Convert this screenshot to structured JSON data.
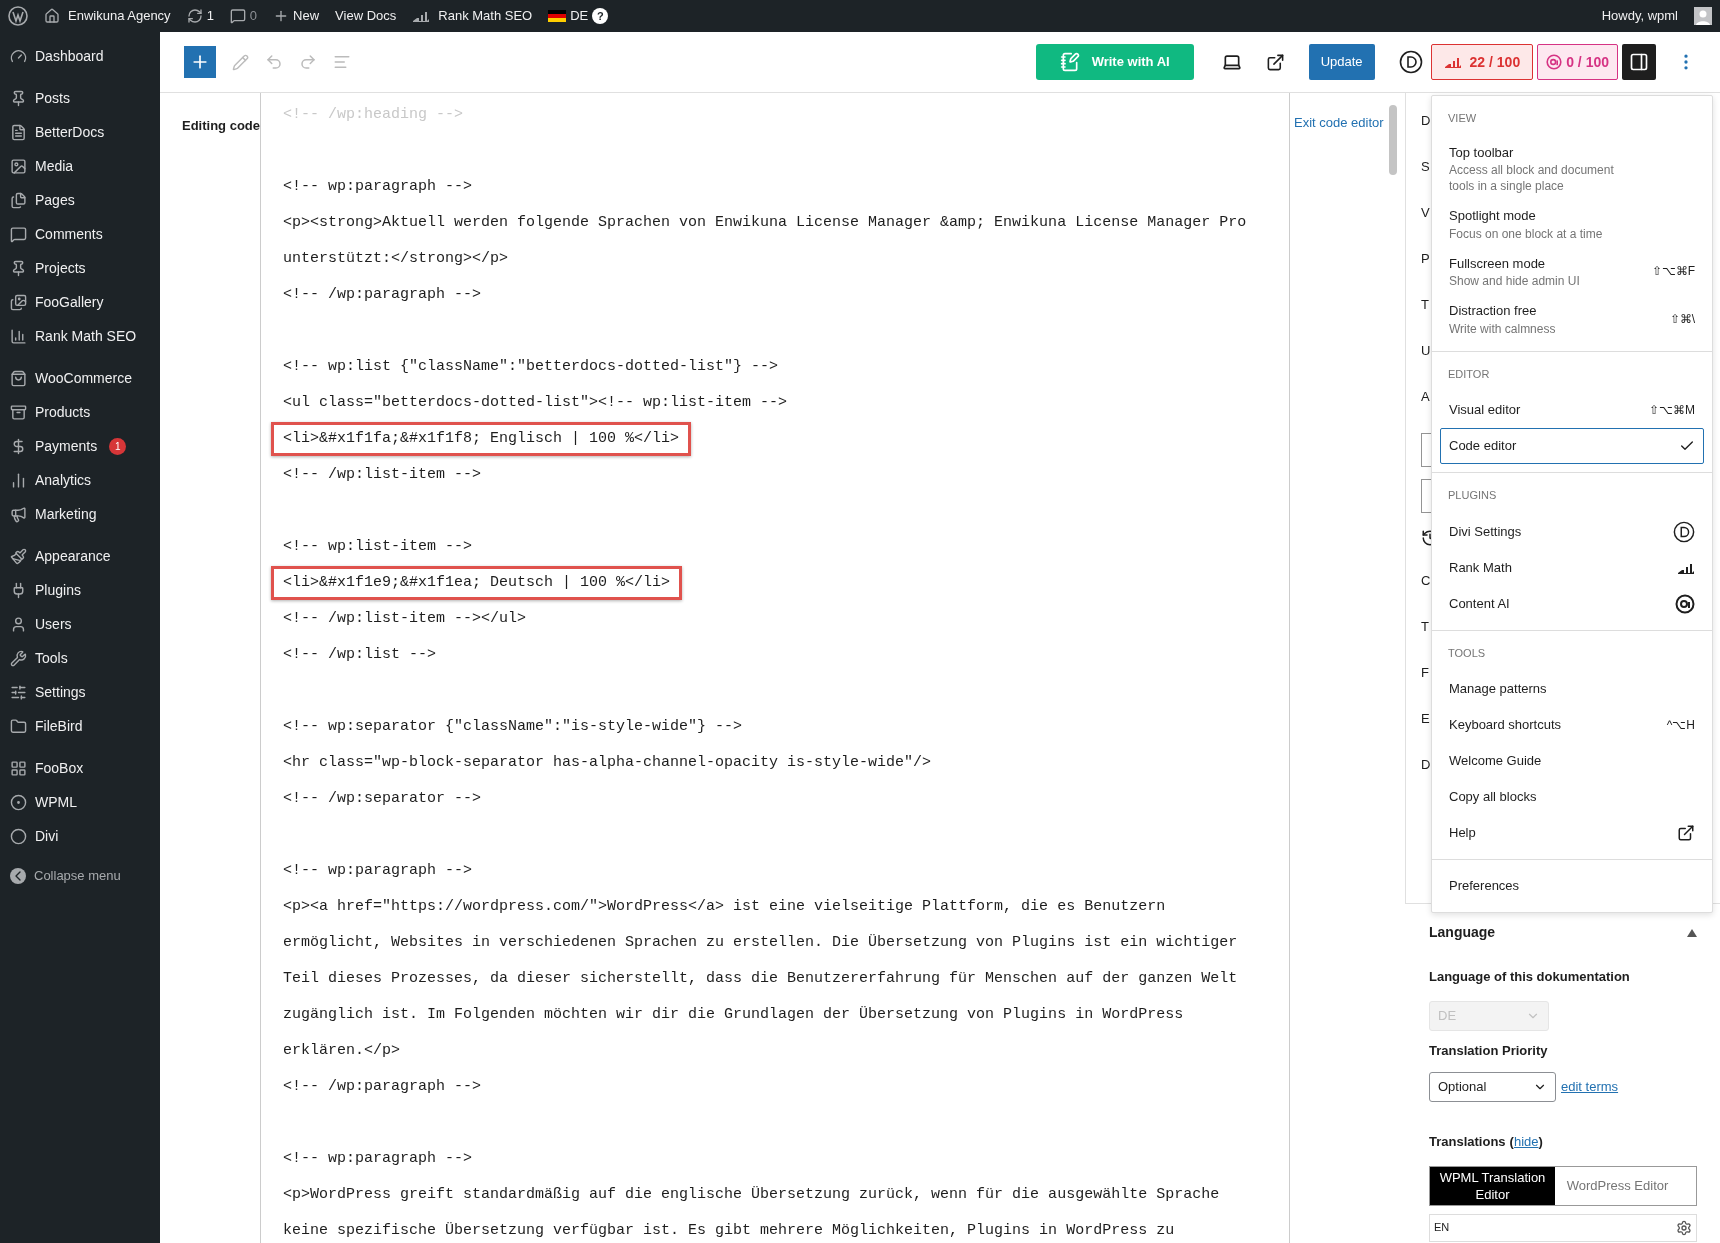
{
  "admin_bar": {
    "site": "Enwikuna Agency",
    "updates": "1",
    "comments": "0",
    "new": "New",
    "view_docs": "View Docs",
    "seo": "Rank Math SEO",
    "language": "DE",
    "help": "?",
    "greeting": "Howdy, wpml"
  },
  "sidebar": {
    "groups": [
      [
        {
          "label": "Dashboard"
        }
      ],
      [
        {
          "label": "Posts"
        },
        {
          "label": "BetterDocs"
        },
        {
          "label": "Media"
        },
        {
          "label": "Pages"
        },
        {
          "label": "Comments"
        },
        {
          "label": "Projects"
        },
        {
          "label": "FooGallery"
        },
        {
          "label": "Rank Math SEO"
        }
      ],
      [
        {
          "label": "WooCommerce"
        },
        {
          "label": "Products"
        },
        {
          "label": "Payments",
          "badge": "1"
        },
        {
          "label": "Analytics"
        },
        {
          "label": "Marketing"
        }
      ],
      [
        {
          "label": "Appearance"
        },
        {
          "label": "Plugins"
        },
        {
          "label": "Users"
        },
        {
          "label": "Tools"
        },
        {
          "label": "Settings"
        },
        {
          "label": "FileBird"
        }
      ],
      [
        {
          "label": "FooBox"
        },
        {
          "label": "WPML"
        },
        {
          "label": "Divi"
        }
      ]
    ],
    "collapse": "Collapse menu"
  },
  "toolbar": {
    "write_ai": "Write with AI",
    "update": "Update",
    "seo_score": "22 / 100",
    "ai_score": "0 / 100",
    "settings_open": true
  },
  "editor": {
    "label": "Editing code",
    "exit": "Exit code editor",
    "blocks": [
      {
        "dimmed": true,
        "lines": [
          {
            "text": "<!-- /wp:heading -->",
            "highlighted": false
          }
        ]
      },
      {
        "dimmed": false,
        "lines": [
          {
            "text": "<!-- wp:paragraph -->",
            "highlighted": false
          },
          {
            "text": "<p><strong>Aktuell werden folgende Sprachen von Enwikuna License Manager &amp; Enwikuna License Manager Pro",
            "highlighted": false
          },
          {
            "text": "unterstützt:</strong></p>",
            "highlighted": false
          },
          {
            "text": "<!-- /wp:paragraph -->",
            "highlighted": false
          }
        ]
      },
      {
        "dimmed": false,
        "lines": [
          {
            "text": "<!-- wp:list {\"className\":\"betterdocs-dotted-list\"} -->",
            "highlighted": false
          },
          {
            "text": "<ul class=\"betterdocs-dotted-list\"><!-- wp:list-item -->",
            "highlighted": false
          },
          {
            "text": "<li>&#x1f1fa;&#x1f1f8; Englisch | 100 %</li>",
            "highlighted": true
          },
          {
            "text": "<!-- /wp:list-item -->",
            "highlighted": false
          }
        ]
      },
      {
        "dimmed": false,
        "lines": [
          {
            "text": "<!-- wp:list-item -->",
            "highlighted": false
          },
          {
            "text": "<li>&#x1f1e9;&#x1f1ea; Deutsch | 100 %</li>",
            "highlighted": true
          },
          {
            "text": "<!-- /wp:list-item --></ul>",
            "highlighted": false
          },
          {
            "text": "<!-- /wp:list -->",
            "highlighted": false
          }
        ]
      },
      {
        "dimmed": false,
        "lines": [
          {
            "text": "<!-- wp:separator {\"className\":\"is-style-wide\"} -->",
            "highlighted": false
          },
          {
            "text": "<hr class=\"wp-block-separator has-alpha-channel-opacity is-style-wide\"/>",
            "highlighted": false
          },
          {
            "text": "<!-- /wp:separator -->",
            "highlighted": false
          }
        ]
      },
      {
        "dimmed": false,
        "lines": [
          {
            "text": "<!-- wp:paragraph -->",
            "highlighted": false
          },
          {
            "text": "<p><a href=\"https://wordpress.com/\">WordPress</a> ist eine vielseitige Plattform, die es Benutzern",
            "highlighted": false
          },
          {
            "text": "ermöglicht, Websites in verschiedenen Sprachen zu erstellen. Die Übersetzung von Plugins ist ein wichtiger",
            "highlighted": false
          },
          {
            "text": "Teil dieses Prozesses, da dieser sicherstellt, dass die Benutzererfahrung für Menschen auf der ganzen Welt",
            "highlighted": false
          },
          {
            "text": "zugänglich ist. Im Folgenden möchten wir dir die Grundlagen der Übersetzung von Plugins in WordPress",
            "highlighted": false
          },
          {
            "text": "erklären.</p>",
            "highlighted": false
          },
          {
            "text": "<!-- /wp:paragraph -->",
            "highlighted": false
          }
        ]
      },
      {
        "dimmed": false,
        "lines": [
          {
            "text": "<!-- wp:paragraph -->",
            "highlighted": false
          },
          {
            "text": "<p>WordPress greift standardmäßig auf die englische Übersetzung zurück, wenn für die ausgewählte Sprache",
            "highlighted": false
          },
          {
            "text": "keine spezifische Übersetzung verfügbar ist. Es gibt mehrere Möglichkeiten, Plugins in WordPress zu",
            "highlighted": false
          }
        ]
      }
    ]
  },
  "settings_peek": [
    {
      "kind": "letter",
      "text": "D"
    },
    {
      "kind": "letter",
      "text": "S"
    },
    {
      "kind": "letter",
      "text": "V"
    },
    {
      "kind": "letter",
      "text": "P"
    },
    {
      "kind": "letter",
      "text": "T"
    },
    {
      "kind": "letter",
      "text": "U"
    },
    {
      "kind": "letter",
      "text": "A"
    },
    {
      "kind": "field"
    },
    {
      "kind": "field"
    },
    {
      "kind": "history"
    },
    {
      "kind": "letter",
      "text": "C"
    },
    {
      "kind": "letter",
      "text": "T"
    },
    {
      "kind": "letter",
      "text": "F"
    },
    {
      "kind": "letter",
      "text": "E"
    },
    {
      "kind": "letter",
      "text": "D"
    }
  ],
  "options_menu": {
    "sections": [
      {
        "title": "VIEW",
        "items": [
          {
            "label": "Top toolbar",
            "description": "Access all block and document tools in a single place",
            "selected": false
          },
          {
            "label": "Spotlight mode",
            "description": "Focus on one block at a time",
            "selected": false
          },
          {
            "label": "Fullscreen mode",
            "description": "Show and hide admin UI",
            "shortcut": "⇧⌥⌘F",
            "selected": false
          },
          {
            "label": "Distraction free",
            "description": "Write with calmness",
            "shortcut": "⇧⌘\\",
            "selected": false
          }
        ]
      },
      {
        "title": "EDITOR",
        "items": [
          {
            "label": "Visual editor",
            "shortcut": "⇧⌥⌘M",
            "selected": false
          },
          {
            "label": "Code editor",
            "selected": true
          }
        ]
      },
      {
        "title": "PLUGINS",
        "items": [
          {
            "label": "Divi Settings",
            "selected": false
          },
          {
            "label": "Rank Math",
            "selected": false
          },
          {
            "label": "Content AI",
            "selected": false
          }
        ]
      },
      {
        "title": "TOOLS",
        "items": [
          {
            "label": "Manage patterns",
            "selected": false
          },
          {
            "label": "Keyboard shortcuts",
            "shortcut": "^⌥H",
            "selected": false
          },
          {
            "label": "Welcome Guide",
            "selected": false
          },
          {
            "label": "Copy all blocks",
            "selected": false
          },
          {
            "label": "Help",
            "selected": false
          }
        ]
      },
      {
        "items": [
          {
            "label": "Preferences",
            "selected": false
          }
        ]
      }
    ]
  },
  "language_panel": {
    "title": "Language",
    "expanded": true,
    "language_label": "Language of this dokumentation",
    "language_value": "DE",
    "priority_label": "Translation Priority",
    "priority_value": "Optional",
    "edit_terms": "edit terms",
    "translations_label": "Translations",
    "hide_open": "(",
    "hide": "hide",
    "hide_close": ")",
    "editor_choice": [
      {
        "label": "WPML Translation Editor",
        "selected": true
      },
      {
        "label": "WordPress Editor",
        "selected": false
      }
    ],
    "translation_row": "EN"
  }
}
